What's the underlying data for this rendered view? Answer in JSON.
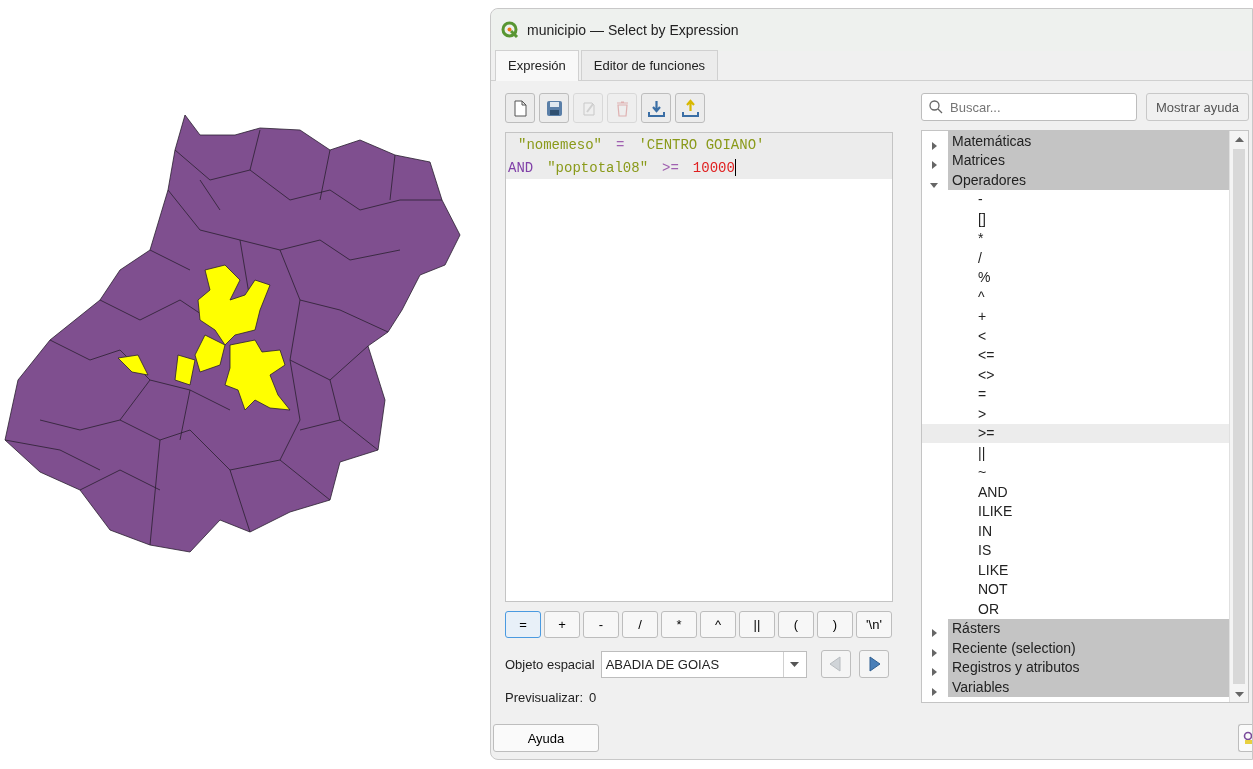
{
  "window": {
    "title": "municipio — Select by Expression"
  },
  "tabs": [
    {
      "label": "Expresión",
      "selected": true
    },
    {
      "label": "Editor de funciones",
      "selected": false
    }
  ],
  "toolbar": [
    {
      "kind": "new",
      "disabled": false
    },
    {
      "kind": "save",
      "disabled": false
    },
    {
      "kind": "edit",
      "disabled": true
    },
    {
      "kind": "delete",
      "disabled": true
    },
    {
      "kind": "import",
      "disabled": false
    },
    {
      "kind": "export",
      "disabled": false
    }
  ],
  "editor": {
    "lines": [
      [
        {
          "kind": "field",
          "text": "\"nomemeso\""
        },
        {
          "kind": "operator",
          "text": "="
        },
        {
          "kind": "string",
          "text": "'CENTRO GOIANO'"
        }
      ],
      [
        {
          "kind": "keyword",
          "text": "AND"
        },
        {
          "kind": "field",
          "text": "\"poptotal08\""
        },
        {
          "kind": "operator",
          "text": ">="
        },
        {
          "kind": "number",
          "text": "10000"
        }
      ]
    ]
  },
  "operator_buttons": [
    {
      "label": "=",
      "focused": true
    },
    {
      "label": "+",
      "focused": false
    },
    {
      "label": "-",
      "focused": false
    },
    {
      "label": "/",
      "focused": false
    },
    {
      "label": "*",
      "focused": false
    },
    {
      "label": "^",
      "focused": false
    },
    {
      "label": "||",
      "focused": false
    },
    {
      "label": "(",
      "focused": false
    },
    {
      "label": ")",
      "focused": false
    },
    {
      "label": "'\\n'",
      "focused": false
    }
  ],
  "spatial_object": {
    "label": "Objeto espacial",
    "value": "ABADIA DE GOIAS",
    "previous_disabled": true,
    "next_disabled": false
  },
  "preview": {
    "label": "Previsualizar:",
    "value": "0"
  },
  "help_button": "Ayuda",
  "search": {
    "placeholder": "Buscar..."
  },
  "show_help_button": "Mostrar ayuda",
  "tree": [
    {
      "label": "Matemáticas",
      "expanded": false
    },
    {
      "label": "Matrices",
      "expanded": false
    },
    {
      "label": "Operadores",
      "expanded": true,
      "children": [
        {
          "label": "-",
          "selected": false
        },
        {
          "label": "[]",
          "selected": false
        },
        {
          "label": "*",
          "selected": false
        },
        {
          "label": "/",
          "selected": false
        },
        {
          "label": "%",
          "selected": false
        },
        {
          "label": "^",
          "selected": false
        },
        {
          "label": "+",
          "selected": false
        },
        {
          "label": "<",
          "selected": false
        },
        {
          "label": "<=",
          "selected": false
        },
        {
          "label": "<>",
          "selected": false
        },
        {
          "label": "=",
          "selected": false
        },
        {
          "label": ">",
          "selected": false
        },
        {
          "label": ">=",
          "selected": true
        },
        {
          "label": "||",
          "selected": false
        },
        {
          "label": "~",
          "selected": false
        },
        {
          "label": "AND",
          "selected": false
        },
        {
          "label": "ILIKE",
          "selected": false
        },
        {
          "label": "IN",
          "selected": false
        },
        {
          "label": "IS",
          "selected": false
        },
        {
          "label": "LIKE",
          "selected": false
        },
        {
          "label": "NOT",
          "selected": false
        },
        {
          "label": "OR",
          "selected": false
        }
      ]
    },
    {
      "label": "Rásters",
      "expanded": false
    },
    {
      "label": "Reciente (selection)",
      "expanded": false
    },
    {
      "label": "Registros y atributos",
      "expanded": false
    },
    {
      "label": "Variables",
      "expanded": false
    }
  ]
}
